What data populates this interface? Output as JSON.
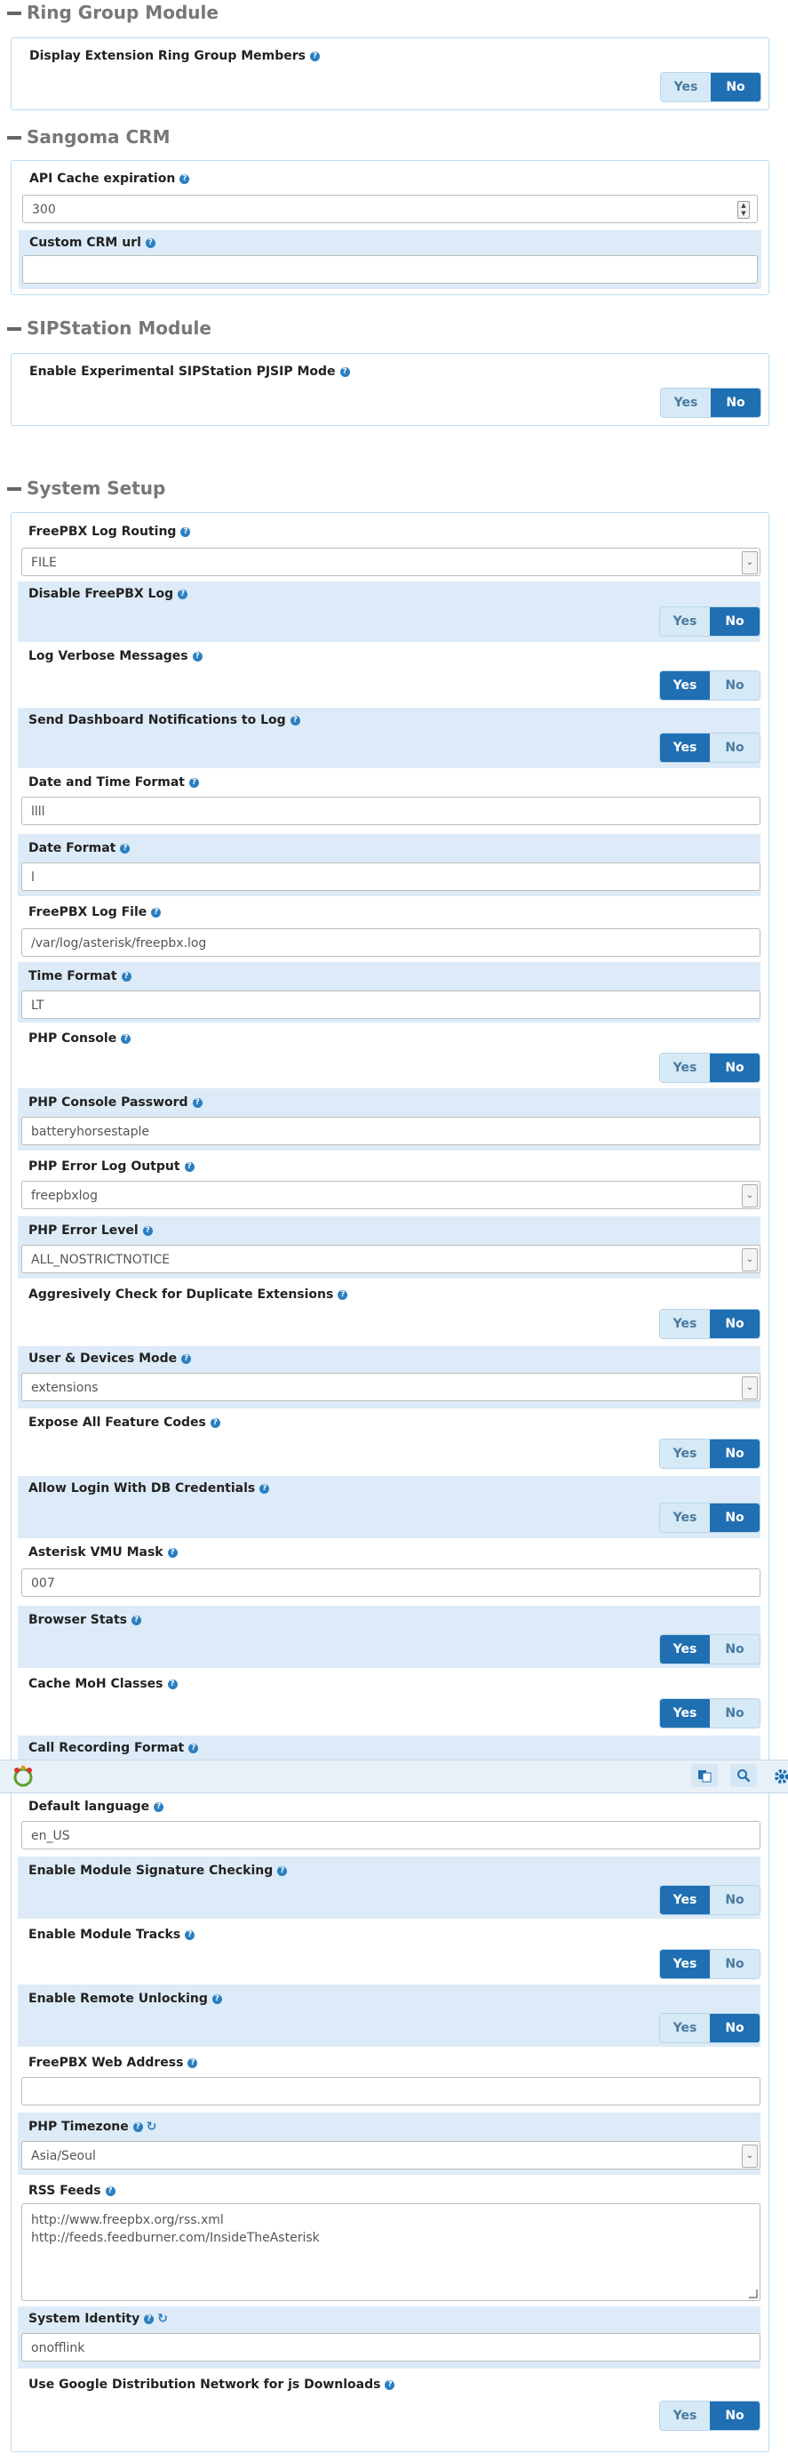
{
  "sections": {
    "ring_group": "Ring Group Module",
    "sangoma_crm": "Sangoma CRM",
    "sipstation": "SIPStation Module",
    "system_setup": "System Setup"
  },
  "toggle_labels": {
    "yes": "Yes",
    "no": "No"
  },
  "settings": {
    "display_ext_ring_group": {
      "label": "Display Extension Ring Group Members",
      "value": "No"
    },
    "api_cache_expiration": {
      "label": "API Cache expiration",
      "value": "300"
    },
    "custom_crm_url": {
      "label": "Custom CRM url",
      "value": ""
    },
    "sipstation_pjsip": {
      "label": "Enable Experimental SIPStation PJSIP Mode",
      "value": "No"
    },
    "log_routing": {
      "label": "FreePBX Log Routing",
      "value": "FILE"
    },
    "disable_log": {
      "label": "Disable FreePBX Log",
      "value": "No"
    },
    "log_verbose": {
      "label": "Log Verbose Messages",
      "value": "Yes"
    },
    "dashboard_notifications": {
      "label": "Send Dashboard Notifications to Log",
      "value": "Yes"
    },
    "datetime_format": {
      "label": "Date and Time Format",
      "value": "llll"
    },
    "date_format": {
      "label": "Date Format",
      "value": "l"
    },
    "log_file": {
      "label": "FreePBX Log File",
      "value": "/var/log/asterisk/freepbx.log"
    },
    "time_format": {
      "label": "Time Format",
      "value": "LT"
    },
    "php_console": {
      "label": "PHP Console",
      "value": "No"
    },
    "php_console_password": {
      "label": "PHP Console Password",
      "value": "batteryhorsestaple"
    },
    "php_error_log_output": {
      "label": "PHP Error Log Output",
      "value": "freepbxlog"
    },
    "php_error_level": {
      "label": "PHP Error Level",
      "value": "ALL_NOSTRICTNOTICE"
    },
    "check_duplicate_ext": {
      "label": "Aggresively Check for Duplicate Extensions",
      "value": "No"
    },
    "user_devices_mode": {
      "label": "User & Devices Mode",
      "value": "extensions"
    },
    "expose_feature_codes": {
      "label": "Expose All Feature Codes",
      "value": "No"
    },
    "login_db_credentials": {
      "label": "Allow Login With DB Credentials",
      "value": "No"
    },
    "vmu_mask": {
      "label": "Asterisk VMU Mask",
      "value": "007"
    },
    "browser_stats": {
      "label": "Browser Stats",
      "value": "Yes"
    },
    "cache_moh": {
      "label": "Cache MoH Classes",
      "value": "Yes"
    },
    "call_recording_format": {
      "label": "Call Recording Format"
    },
    "default_language": {
      "label": "Default language",
      "value": "en_US"
    },
    "module_signature": {
      "label": "Enable Module Signature Checking",
      "value": "Yes"
    },
    "module_tracks": {
      "label": "Enable Module Tracks",
      "value": "Yes"
    },
    "remote_unlocking": {
      "label": "Enable Remote Unlocking",
      "value": "No"
    },
    "web_address": {
      "label": "FreePBX Web Address",
      "value": ""
    },
    "php_timezone": {
      "label": "PHP Timezone",
      "value": "Asia/Seoul"
    },
    "rss_feeds": {
      "label": "RSS Feeds",
      "line1": "http://www.freepbx.org/rss.xml",
      "line2": "http://feeds.feedburner.com/InsideTheAsterisk"
    },
    "system_identity": {
      "label": "System Identity",
      "value": "onofflink"
    },
    "google_cdn": {
      "label": "Use Google Distribution Network for js Downloads",
      "value": "No"
    }
  },
  "icons": {
    "help": "help-icon",
    "refresh": "refresh-icon",
    "logo": "freepbx-logo-icon",
    "search": "search-icon",
    "settings": "gear-icon",
    "translate": "translate-icon"
  }
}
